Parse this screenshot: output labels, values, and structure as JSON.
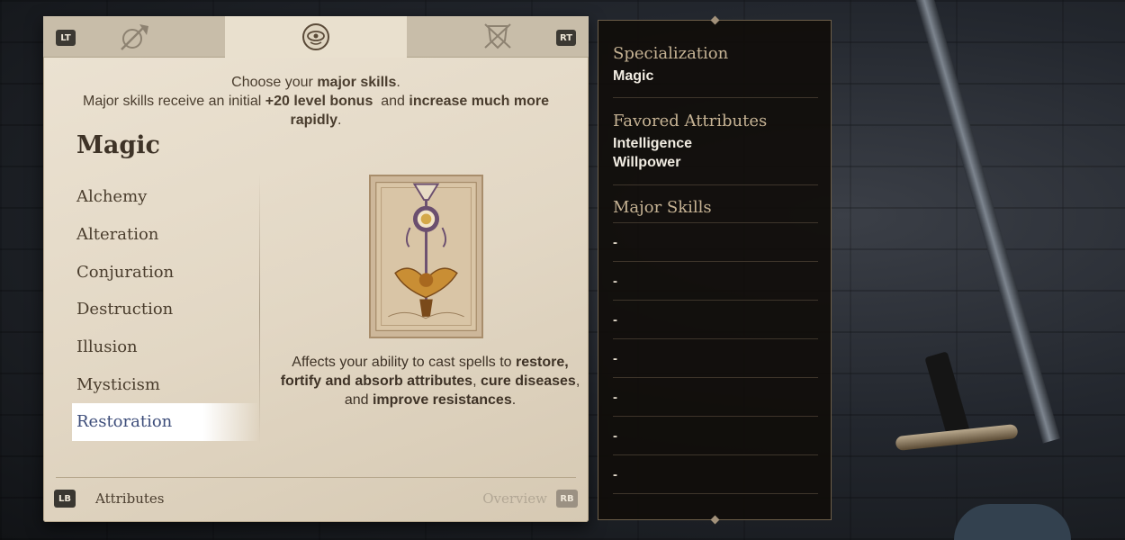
{
  "tabs": [
    {
      "icon": "axe-shield-icon",
      "state": "inactive"
    },
    {
      "icon": "magic-eye-icon",
      "state": "active"
    },
    {
      "icon": "thief-mask-icon",
      "state": "inactive"
    }
  ],
  "controller": {
    "left_tab_button": "LT",
    "right_tab_button": "RT",
    "back_button": "LB",
    "next_button": "RB"
  },
  "intro": {
    "line1_prefix": "Choose your ",
    "line1_bold": "major skills",
    "line1_suffix": ".",
    "line2_prefix": "Major skills receive an initial ",
    "line2_bold1": "+20 level bonus",
    "line2_mid": "  and ",
    "line2_bold2": "increase much more rapidly",
    "line2_suffix": "."
  },
  "category": {
    "title": "Magic",
    "skills": [
      "Alchemy",
      "Alteration",
      "Conjuration",
      "Destruction",
      "Illusion",
      "Mysticism",
      "Restoration"
    ],
    "selected_index": 6
  },
  "description": {
    "part1": "Affects your ability to cast spells to ",
    "bold1": "restore, fortify and absorb attributes",
    "part2": ", ",
    "bold2": "cure diseases",
    "part3": ", and ",
    "bold3": "improve resistances",
    "part4": "."
  },
  "footer": {
    "left_label": "Attributes",
    "right_label": "Overview"
  },
  "summary": {
    "specialization_heading": "Specialization",
    "specialization_value": "Magic",
    "attributes_heading": "Favored Attributes",
    "attributes": [
      "Intelligence",
      "Willpower"
    ],
    "major_skills_heading": "Major Skills",
    "major_skills": [
      "-",
      "-",
      "-",
      "-",
      "-",
      "-",
      "-"
    ]
  },
  "colors": {
    "parchment": "#e6dccb",
    "selected_skill": "#3d4d7a",
    "panel_bg": "#100d0a",
    "heading_gold": "#c6b394"
  }
}
